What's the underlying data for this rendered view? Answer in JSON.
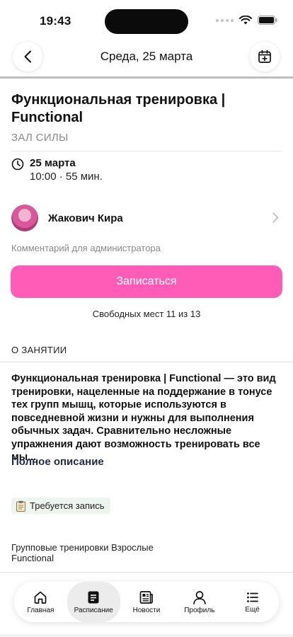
{
  "status": {
    "time": "19:43"
  },
  "header": {
    "title": "Среда, 25 марта"
  },
  "event": {
    "title": "Функциональная тренировка | Functional",
    "hall": "ЗАЛ СИЛЫ",
    "date": "25 марта",
    "time": "10:00 · 55 мин."
  },
  "trainer": {
    "name": "Жакович Кира"
  },
  "comment_label": "Комментарий для администратора",
  "cta": {
    "label": "Записаться",
    "color": "#ff5cb8"
  },
  "seats": "Свободных мест 11 из 13",
  "about": {
    "heading": "О ЗАНЯТИИ",
    "description": "Функциональная тренировка | Functional — это вид тренировки, нацеленные на поддержание в тонусе тех групп мышц, которые используются в повседневной жизни и нужны для выполнения обычных задач. Сравнительно несложные упражнения дают возможность тренировать все мы...",
    "full_link": "Полное описание"
  },
  "badge": {
    "label": "Требуется запись",
    "icon": "clipboard-icon"
  },
  "tags": {
    "line1": "Групповые тренировки Взрослые",
    "line2": "Functional"
  },
  "tab_bar": {
    "items": [
      {
        "label": "Главная",
        "icon": "home-icon"
      },
      {
        "label": "Расписание",
        "icon": "schedule-icon"
      },
      {
        "label": "Новости",
        "icon": "news-icon"
      },
      {
        "label": "Профиль",
        "icon": "profile-icon"
      },
      {
        "label": "Ещё",
        "icon": "more-icon"
      }
    ],
    "active": "Расписание"
  }
}
